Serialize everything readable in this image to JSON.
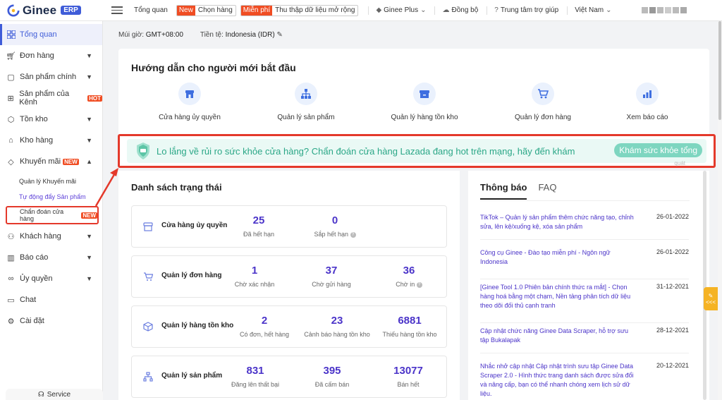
{
  "app": {
    "logo_text": "Ginee",
    "logo_badge": "ERP"
  },
  "topbar": {
    "overview": "Tổng quan",
    "pill1": {
      "tag": "New",
      "text": "Chọn hàng"
    },
    "pill2": {
      "tag": "Miễn phí",
      "text": "Thu thập dữ liệu mở rộng"
    },
    "ginee_plus": "Ginee Plus",
    "sync": "Đồng bộ",
    "help": "Trung tâm trợ giúp",
    "language": "Việt Nam"
  },
  "sidebar": {
    "items": [
      {
        "label": "Tổng quan",
        "icon": "grid-icon",
        "active": true
      },
      {
        "label": "Đơn hàng",
        "icon": "cart-icon"
      },
      {
        "label": "Sản phẩm chính",
        "icon": "bag-icon"
      },
      {
        "label": "Sản phẩm của Kênh",
        "icon": "sitemap-icon",
        "badge": "HOT"
      },
      {
        "label": "Tồn kho",
        "icon": "box-icon"
      },
      {
        "label": "Kho hàng",
        "icon": "warehouse-icon"
      },
      {
        "label": "Khuyến mãi",
        "icon": "tag-icon",
        "badge": "NEW"
      },
      {
        "label": "Khách hàng",
        "icon": "users-icon"
      },
      {
        "label": "Báo cáo",
        "icon": "chart-icon"
      },
      {
        "label": "Ủy quyền",
        "icon": "link-icon"
      },
      {
        "label": "Chat",
        "icon": "chat-icon"
      },
      {
        "label": "Cài đặt",
        "icon": "gear-icon"
      }
    ],
    "sub_items": [
      {
        "label": "Quản lý Khuyến mãi"
      },
      {
        "label": "Tự động đẩy Sản phẩm"
      },
      {
        "label": "Chẩn đoán cửa hàng",
        "badge": "NEW"
      }
    ],
    "service": "Service"
  },
  "info": {
    "timezone_label": "Múi giờ:",
    "timezone": "GMT+08:00",
    "currency_label": "Tiền tệ:",
    "currency": "Indonesia (IDR)"
  },
  "guide": {
    "title": "Hướng dẫn cho người mới bắt đầu",
    "items": [
      {
        "label": "Cửa hàng ủy quyền",
        "icon": "store-icon"
      },
      {
        "label": "Quản lý sản phẩm",
        "icon": "sitemap-icon"
      },
      {
        "label": "Quản lý hàng tồn kho",
        "icon": "inventory-icon"
      },
      {
        "label": "Quản lý đơn hàng",
        "icon": "cart-icon"
      },
      {
        "label": "Xem báo cáo",
        "icon": "bar-chart-icon"
      }
    ]
  },
  "banner": {
    "text": "Lo lắng về rủi ro sức khỏe cửa hàng? Chẩn đoán cửa hàng Lazada đang hot trên mạng, hãy đến khám",
    "button": "Khám sức khỏe tổng",
    "button_overflow": "quát"
  },
  "status": {
    "title": "Danh sách trạng thái",
    "cards": [
      {
        "name": "Cửa hàng ủy quyền",
        "values": [
          {
            "num": "25",
            "label": "Đã hết hạn"
          },
          {
            "num": "0",
            "label": "Sắp hết hạn",
            "help": true
          }
        ]
      },
      {
        "name": "Quản lý đơn hàng",
        "values": [
          {
            "num": "1",
            "label": "Chờ xác nhận"
          },
          {
            "num": "37",
            "label": "Chờ gửi hàng"
          },
          {
            "num": "36",
            "label": "Chờ in",
            "help": true
          }
        ]
      },
      {
        "name": "Quản lý hàng tồn kho",
        "values": [
          {
            "num": "2",
            "label": "Có đơn, hết hàng"
          },
          {
            "num": "23",
            "label": "Cảnh báo hàng tồn kho"
          },
          {
            "num": "6881",
            "label": "Thiếu hàng tồn kho"
          }
        ]
      },
      {
        "name": "Quản lý sản phẩm",
        "values": [
          {
            "num": "831",
            "label": "Đăng lên thất bại"
          },
          {
            "num": "395",
            "label": "Đã cấm bán"
          },
          {
            "num": "13077",
            "label": "Bán hết"
          }
        ]
      }
    ]
  },
  "news": {
    "tabs": [
      "Thông báo",
      "FAQ"
    ],
    "items": [
      {
        "title": "TikTok – Quản lý sản phẩm thêm chức năng tạo, chỉnh sửa, lên kệ/xuống kệ, xóa sản phẩm",
        "date": "26-01-2022"
      },
      {
        "title": "Công cụ Ginee - Đào tạo miễn phí - Ngôn ngữ Indonesia",
        "date": "26-01-2022"
      },
      {
        "title": "[Ginee Tool 1.0 Phiên bản chính thức ra mắt] - Chọn hàng hoá bằng một chạm, Nền tảng phân tích dữ liệu theo dõi đối thủ cạnh tranh",
        "date": "31-12-2021"
      },
      {
        "title": "Cập nhật chức năng Ginee Data Scraper, hỗ trợ sưu tập Bukalapak",
        "date": "28-12-2021"
      },
      {
        "title": "Nhắc nhở cập nhật Cập nhật trình sưu tập Ginee Data Scraper 2.0 - Hình thức trang danh sách được sửa đổi và nâng cấp, bạn có thể nhanh chóng xem lịch sử dữ liệu.",
        "date": "20-12-2021"
      }
    ]
  },
  "float_tab": "<<<",
  "colors": {
    "accent": "#3f5cd8",
    "number": "#4b34c9",
    "highlight": "#e4392b",
    "banner_text": "#2ba787",
    "new_badge": "#f04d23"
  }
}
